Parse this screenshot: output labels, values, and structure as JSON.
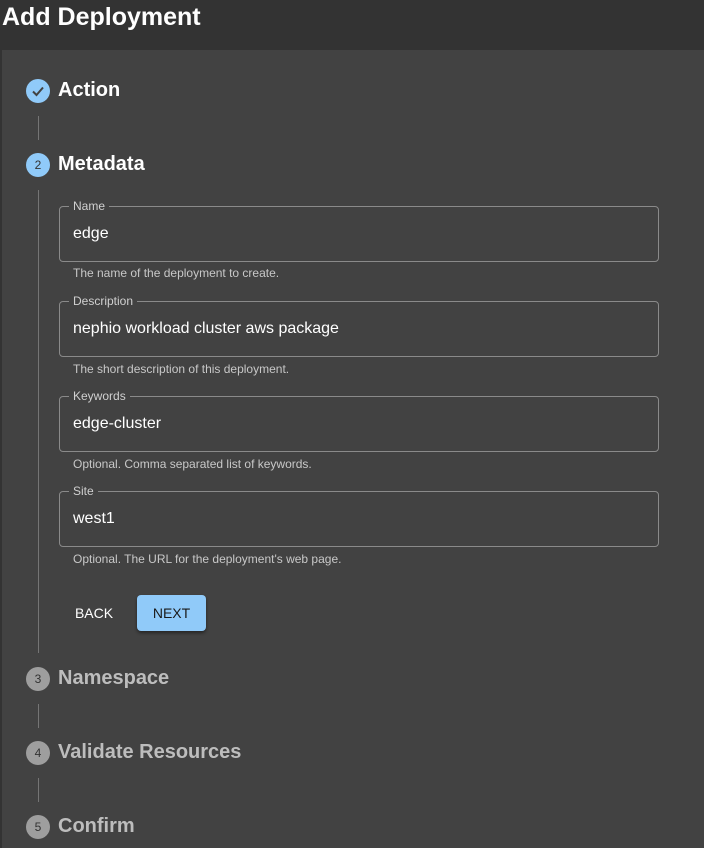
{
  "header": {
    "title": "Add Deployment"
  },
  "colors": {
    "accent": "#90caf9",
    "inactive_step": "#9e9e9e",
    "panel": "#424242"
  },
  "steps": [
    {
      "number": "1",
      "label": "Action",
      "state": "completed",
      "icon": "check-icon"
    },
    {
      "number": "2",
      "label": "Metadata",
      "state": "active"
    },
    {
      "number": "3",
      "label": "Namespace",
      "state": "pending"
    },
    {
      "number": "4",
      "label": "Validate Resources",
      "state": "pending"
    },
    {
      "number": "5",
      "label": "Confirm",
      "state": "pending"
    }
  ],
  "form": {
    "fields": [
      {
        "label": "Name",
        "value": "edge",
        "helper": "The name of the deployment to create."
      },
      {
        "label": "Description",
        "value": "nephio workload cluster aws package",
        "helper": "The short description of this deployment."
      },
      {
        "label": "Keywords",
        "value": "edge-cluster",
        "helper": "Optional. Comma separated list of keywords."
      },
      {
        "label": "Site",
        "value": "west1",
        "helper": "Optional. The URL for the deployment's web page."
      }
    ],
    "back_label": "BACK",
    "next_label": "NEXT"
  }
}
